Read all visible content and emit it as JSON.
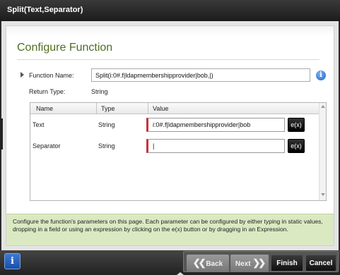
{
  "window": {
    "title": "Split(Text,Separator)"
  },
  "page": {
    "heading": "Configure Function"
  },
  "function": {
    "name_label": "Function Name:",
    "name_value": "Split(i:0#.f|ldapmembershipprovider|bob,|)",
    "return_type_label": "Return Type:",
    "return_type_value": "String",
    "info_icon": "info-icon"
  },
  "grid": {
    "columns": [
      "Name",
      "Type",
      "Value"
    ],
    "rows": [
      {
        "name": "Text",
        "type": "String",
        "value": "i:0#.f|ldapmembershipprovider|bob",
        "expr_label": "e(x)"
      },
      {
        "name": "Separator",
        "type": "String",
        "value": "|",
        "expr_label": "e(x)"
      }
    ]
  },
  "help_text": "Configure the function's parameters on this page.  Each parameter can be configured by either typing in static values, dropping in a field or using an expression by clicking on the e(x) button or by dragging in an Expression.",
  "footer": {
    "info_label": "i",
    "back_label": "Back",
    "next_label": "Next",
    "finish_label": "Finish",
    "cancel_label": "Cancel"
  },
  "colors": {
    "heading": "#4f6e1f",
    "required_marker": "#c8323a",
    "help_background": "#dbe9c3",
    "info_blue": "#1f63c6"
  }
}
